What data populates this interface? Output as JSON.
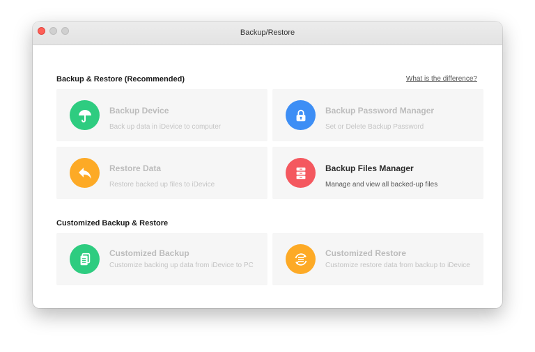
{
  "window": {
    "title": "Backup/Restore"
  },
  "section1": {
    "title": "Backup & Restore (Recommended)",
    "link": "What is the difference?"
  },
  "section2": {
    "title": "Customized Backup & Restore"
  },
  "cards": [
    {
      "title": "Backup Device",
      "desc": "Back up data in iDevice to computer",
      "icon": "umbrella-icon",
      "color": "#2ecc80",
      "enabled": false
    },
    {
      "title": "Backup Password Manager",
      "desc": "Set or Delete Backup Password",
      "icon": "lock-icon",
      "color": "#3d8ef5",
      "enabled": false
    },
    {
      "title": "Restore Data",
      "desc": "Restore backed up files to iDevice",
      "icon": "undo-arrow-icon",
      "color": "#fdaa26",
      "enabled": false
    },
    {
      "title": "Backup Files Manager",
      "desc": "Manage and view all backed-up files",
      "icon": "cabinet-icon",
      "color": "#f4585f",
      "enabled": true
    },
    {
      "title": "Customized Backup",
      "desc": "Customize backing up data from iDevice to PC",
      "icon": "documents-icon",
      "color": "#2ecc80",
      "enabled": false
    },
    {
      "title": "Customized Restore",
      "desc": "Customize restore data from backup to iDevice",
      "icon": "sync-list-icon",
      "color": "#fdaa26",
      "enabled": false
    }
  ]
}
